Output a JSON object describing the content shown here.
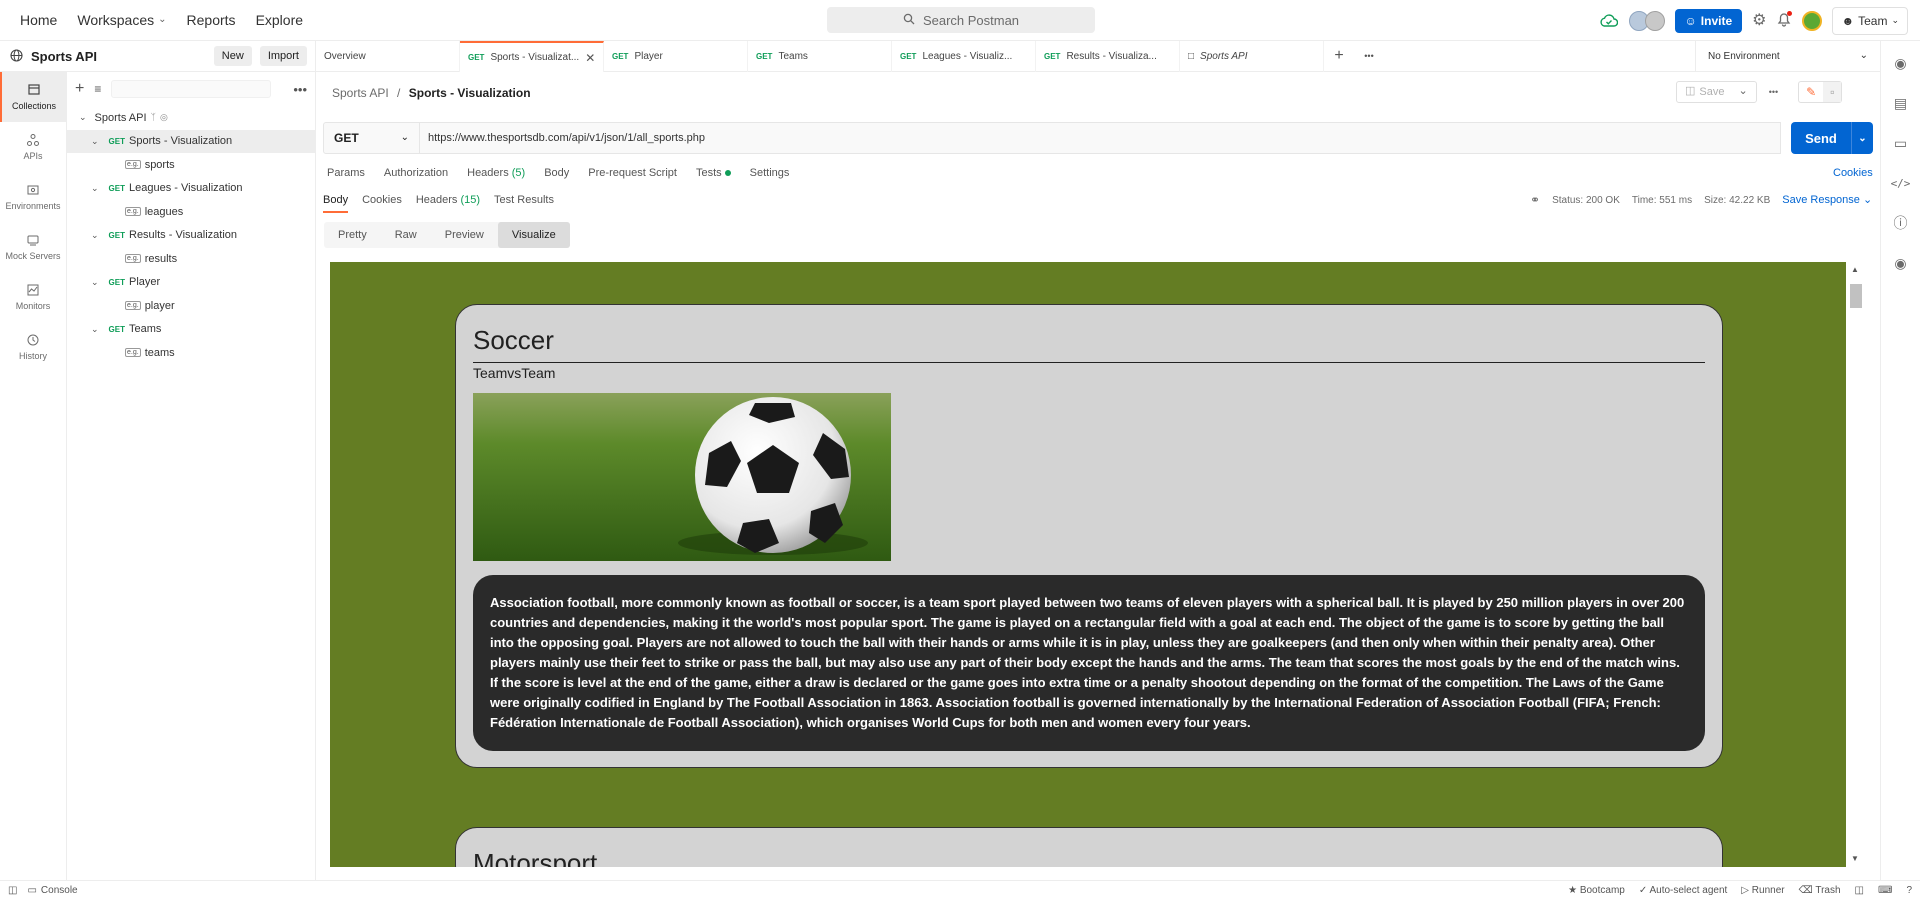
{
  "topnav": {
    "home": "Home",
    "workspaces": "Workspaces",
    "reports": "Reports",
    "explore": "Explore",
    "search_placeholder": "Search Postman",
    "invite": "Invite",
    "team": "Team"
  },
  "workspace": {
    "title": "Sports API",
    "new_label": "New",
    "import_label": "Import"
  },
  "rail": [
    {
      "label": "Collections",
      "icon": "collections-icon"
    },
    {
      "label": "APIs",
      "icon": "apis-icon"
    },
    {
      "label": "Environments",
      "icon": "environments-icon"
    },
    {
      "label": "Mock Servers",
      "icon": "mock-servers-icon"
    },
    {
      "label": "Monitors",
      "icon": "monitors-icon"
    },
    {
      "label": "History",
      "icon": "history-icon"
    }
  ],
  "tree": {
    "collection": "Sports API",
    "requests": [
      {
        "method": "GET",
        "name": "Sports - Visualization",
        "example": "sports"
      },
      {
        "method": "GET",
        "name": "Leagues - Visualization",
        "example": "leagues"
      },
      {
        "method": "GET",
        "name": "Results - Visualization",
        "example": "results"
      },
      {
        "method": "GET",
        "name": "Player",
        "example": "player"
      },
      {
        "method": "GET",
        "name": "Teams",
        "example": "teams"
      }
    ]
  },
  "tabs": {
    "overview": "Overview",
    "t1": {
      "method": "GET",
      "name": "Sports - Visualizat..."
    },
    "t2": {
      "method": "GET",
      "name": "Player"
    },
    "t3": {
      "method": "GET",
      "name": "Teams"
    },
    "t4": {
      "method": "GET",
      "name": "Leagues - Visualiz..."
    },
    "t5": {
      "method": "GET",
      "name": "Results - Visualiza..."
    },
    "t6": {
      "name": "Sports API"
    },
    "environment": "No Environment"
  },
  "request": {
    "crumb_parent": "Sports API",
    "crumb_sep": "/",
    "crumb_current": "Sports - Visualization",
    "save": "Save",
    "method": "GET",
    "url": "https://www.thesportsdb.com/api/v1/json/1/all_sports.php",
    "send": "Send",
    "tabs": {
      "params": "Params",
      "authorization": "Authorization",
      "headers": "Headers",
      "headers_count": "(5)",
      "body": "Body",
      "prerequest": "Pre-request Script",
      "tests": "Tests",
      "settings": "Settings"
    },
    "cookies": "Cookies"
  },
  "response": {
    "tabs": {
      "body": "Body",
      "cookies": "Cookies",
      "headers": "Headers",
      "headers_count": "(15)",
      "test_results": "Test Results"
    },
    "status": "Status: 200 OK",
    "time": "Time: 551 ms",
    "size": "Size: 42.22 KB",
    "save_response": "Save Response",
    "view_modes": {
      "pretty": "Pretty",
      "raw": "Raw",
      "preview": "Preview",
      "visualize": "Visualize"
    }
  },
  "visualize": {
    "cards": [
      {
        "title": "Soccer",
        "subtitle": "TeamvsTeam",
        "description": "Association football, more commonly known as football or soccer, is a team sport played between two teams of eleven players with a spherical ball. It is played by 250 million players in over 200 countries and dependencies, making it the world's most popular sport. The game is played on a rectangular field with a goal at each end. The object of the game is to score by getting the ball into the opposing goal. Players are not allowed to touch the ball with their hands or arms while it is in play, unless they are goalkeepers (and then only when within their penalty area). Other players mainly use their feet to strike or pass the ball, but may also use any part of their body except the hands and the arms. The team that scores the most goals by the end of the match wins. If the score is level at the end of the game, either a draw is declared or the game goes into extra time or a penalty shootout depending on the format of the competition. The Laws of the Game were originally codified in England by The Football Association in 1863. Association football is governed internationally by the International Federation of Association Football (FIFA; French: Fédération Internationale de Football Association), which organises World Cups for both men and women every four years."
      },
      {
        "title": "Motorsport"
      }
    ],
    "background": "#647d23"
  },
  "statusbar": {
    "console": "Console",
    "bootcamp": "Bootcamp",
    "agent": "Auto-select agent",
    "runner": "Runner",
    "trash": "Trash"
  },
  "colors": {
    "accent": "#ff6c37",
    "primary": "#0265d2",
    "get": "#0f9d58"
  }
}
